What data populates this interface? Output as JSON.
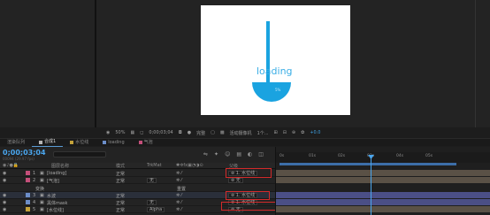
{
  "preview": {
    "loading_text": "loading",
    "bowl_text": "5%",
    "colors": {
      "accent": "#1aa3e0",
      "canvas": "#ffffff"
    }
  },
  "viewer_toolbar": {
    "zoom": "50%",
    "timecode": "0;00;03;04",
    "resolution": "完整",
    "camera": "活动摄像机",
    "views": "1个...",
    "exposure": "+0.0"
  },
  "tabs": [
    {
      "label": "渲染队列",
      "active": false,
      "color": ""
    },
    {
      "label": "合成1",
      "active": true,
      "color": "#b5b5b5"
    },
    {
      "label": "水位线",
      "active": false,
      "color": "#c4a23a"
    },
    {
      "label": "loading",
      "active": false,
      "color": "#6c8ec9"
    },
    {
      "label": "气泡",
      "active": false,
      "color": "#c44f7a"
    }
  ],
  "timeline": {
    "current_time": "0;00;03;04",
    "frame_sub": "00094 (29.97 fps)",
    "columns": {
      "source_name": "图层名称",
      "mode": "模式",
      "trkmat": "TrkMat",
      "parent": "父级"
    },
    "ruler_ticks": [
      "0s",
      "01s",
      "02s",
      "03s",
      "04s",
      "05s"
    ],
    "layers": [
      {
        "num": "1",
        "name": "[loading]",
        "mode": "正常",
        "trkmat": "",
        "parent": "1. 水位线",
        "color": "#c44f7a"
      },
      {
        "num": "2",
        "name": "[气泡]",
        "mode": "正常",
        "trkmat": "无",
        "parent": "无",
        "color": "#c44f7a"
      },
      {
        "num": "",
        "name": "变换",
        "mode": "",
        "trkmat": "",
        "parent": "",
        "color": ""
      },
      {
        "num": "3",
        "name": "水波",
        "mode": "正常",
        "trkmat": "",
        "parent": "1. 水位线",
        "color": "#6c8ec9"
      },
      {
        "num": "4",
        "name": "黑体mask",
        "mode": "正常",
        "trkmat": "无",
        "parent": "1. 水位线",
        "color": "#6c8ec9"
      },
      {
        "num": "5",
        "name": "[水位线]",
        "mode": "正常",
        "trkmat": "Alpha",
        "parent": "无",
        "color": "#c4a23a"
      }
    ],
    "sub_label": "重置"
  }
}
